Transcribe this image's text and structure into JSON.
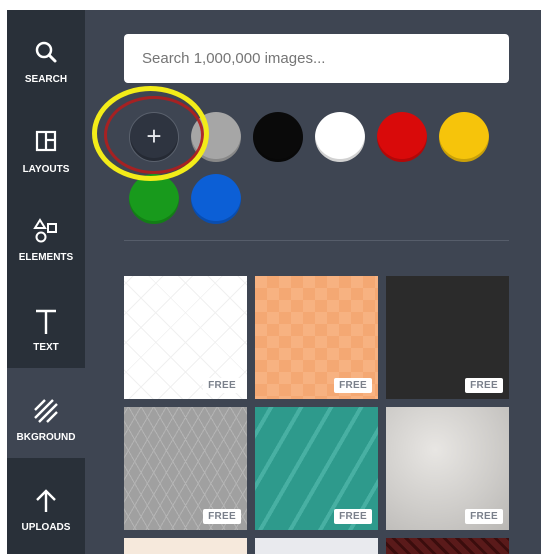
{
  "sidebar": {
    "items": [
      {
        "label": "SEARCH",
        "icon": "search-icon"
      },
      {
        "label": "LAYOUTS",
        "icon": "layouts-icon"
      },
      {
        "label": "ELEMENTS",
        "icon": "shapes-icon"
      },
      {
        "label": "TEXT",
        "icon": "text-icon"
      },
      {
        "label": "BKGROUND",
        "icon": "background-icon"
      },
      {
        "label": "UPLOADS",
        "icon": "upload-arrow-icon"
      }
    ],
    "active": "BKGROUND"
  },
  "search": {
    "placeholder": "Search 1,000,000 images..."
  },
  "colors": {
    "add_symbol": "+",
    "swatches": [
      "#a6a6a6",
      "#0a0a0a",
      "#ffffff",
      "#d90a0a",
      "#f6c40b",
      "#189a1c",
      "#0c5fd6"
    ],
    "highlight_outer": "#f3ec19",
    "highlight_inner": "#b11d1d"
  },
  "backgrounds": {
    "badge": "FREE",
    "tiles": [
      {
        "name": "white-diamond",
        "badge": "FREE"
      },
      {
        "name": "peach-checker",
        "badge": "FREE"
      },
      {
        "name": "dark-solid",
        "badge": "FREE"
      },
      {
        "name": "gray-lattice",
        "badge": "FREE"
      },
      {
        "name": "teal-stripes",
        "badge": "FREE"
      },
      {
        "name": "silver-texture",
        "badge": "FREE"
      },
      {
        "name": "cream",
        "badge": ""
      },
      {
        "name": "light-gray",
        "badge": ""
      },
      {
        "name": "maroon-stripes",
        "badge": ""
      }
    ]
  }
}
